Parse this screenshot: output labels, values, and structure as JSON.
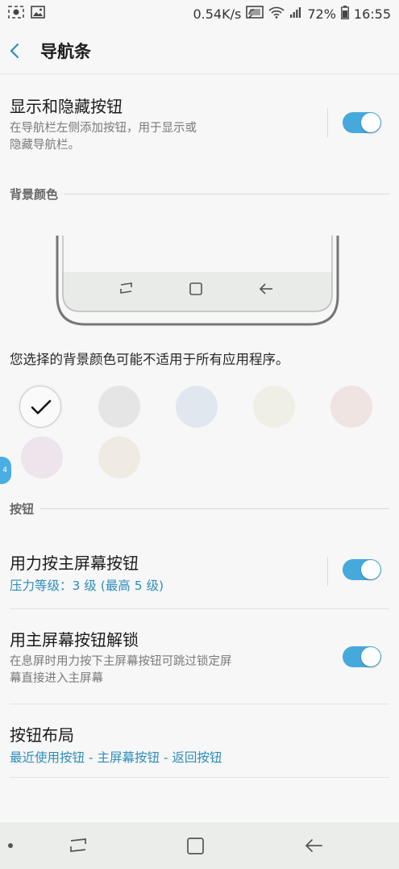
{
  "status": {
    "speed": "0.54K/s",
    "battery": "72%",
    "time": "16:55"
  },
  "header": {
    "title": "导航条"
  },
  "show_hide": {
    "title": "显示和隐藏按钮",
    "description_line1": "在导航栏左侧添加按钮，用于显示或",
    "description_line2": "隐藏导航栏。",
    "enabled": true
  },
  "background": {
    "section_label": "背景颜色",
    "note": "您选择的背景颜色可能不适用于所有应用程序。",
    "swatches": [
      "#fafafa",
      "#e5e5e5",
      "#e1e7ef",
      "#efefe6",
      "#efe4e2",
      "#ede4ec",
      "#f0ebe2"
    ],
    "selected_index": 0
  },
  "buttons": {
    "section_label": "按钮",
    "pressure": {
      "title": "用力按主屏幕按钮",
      "value": "压力等级：3 级 (最高 5 级)",
      "enabled": true
    },
    "unlock": {
      "title": "用主屏幕按钮解锁",
      "description_line1": "在息屏时用力按下主屏幕按钮可跳过锁定屏",
      "description_line2": "幕直接进入主屏幕",
      "enabled": true
    },
    "layout": {
      "title": "按钮布局",
      "value": "最近使用按钮 - 主屏幕按钮 - 返回按钮"
    }
  },
  "edge_badge": {
    "text": "4"
  },
  "colors": {
    "accent": "#46a9dc",
    "link": "#2f8dbd",
    "background": "#f6f7f6"
  }
}
